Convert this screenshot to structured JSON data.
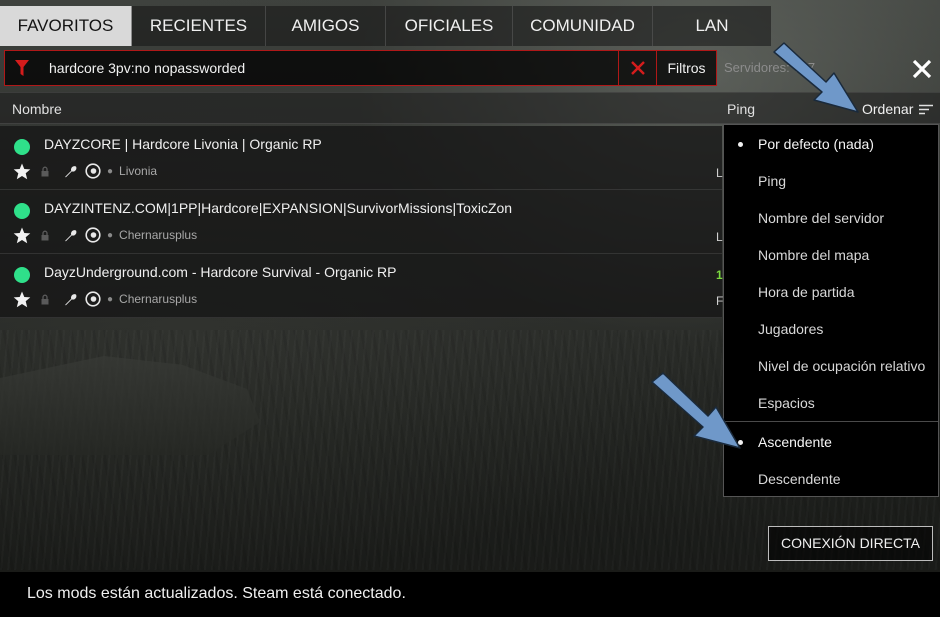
{
  "tabs": [
    {
      "label": "FAVORITOS",
      "active": true
    },
    {
      "label": "RECIENTES",
      "active": false
    },
    {
      "label": "AMIGOS",
      "active": false
    },
    {
      "label": "OFICIALES",
      "active": false
    },
    {
      "label": "COMUNIDAD",
      "active": false
    },
    {
      "label": "LAN",
      "active": false
    }
  ],
  "search": {
    "value": "hardcore 3pv:no nopassworded",
    "filters_label": "Filtros",
    "servers_count": "Servidores: ?/ 7"
  },
  "columns": {
    "name": "Nombre",
    "ping": "Ping",
    "sort_label": "Ordenar"
  },
  "servers": [
    {
      "name": "DAYZCORE | Hardcore Livonia | Organic RP",
      "map": "Livonia",
      "right_peek": "L",
      "right_peek_top": ""
    },
    {
      "name": "DAYZINTENZ.COM|1PP|Hardcore|EXPANSION|SurvivorMissions|ToxicZon",
      "map": "Chernarusplus",
      "right_peek": "L",
      "right_peek_top": ""
    },
    {
      "name": "DayzUnderground.com - Hardcore Survival - Organic RP",
      "map": "Chernarusplus",
      "right_peek": "F",
      "right_peek_top": "1"
    }
  ],
  "sort_menu": {
    "items": [
      {
        "label": "Por defecto (nada)",
        "selected": true
      },
      {
        "label": "Ping",
        "selected": false
      },
      {
        "label": "Nombre del servidor",
        "selected": false
      },
      {
        "label": "Nombre del mapa",
        "selected": false
      },
      {
        "label": "Hora de partida",
        "selected": false
      },
      {
        "label": "Jugadores",
        "selected": false
      },
      {
        "label": "Nivel de ocupación relativo",
        "selected": false
      },
      {
        "label": "Espacios",
        "selected": false
      }
    ],
    "order": [
      {
        "label": "Ascendente",
        "selected": true
      },
      {
        "label": "Descendente",
        "selected": false
      }
    ]
  },
  "direct_connect_label": "CONEXIÓN DIRECTA",
  "status_text": "Los mods están actualizados. Steam está conectado.",
  "colors": {
    "accent_red": "#b01818",
    "online_green": "#2fe08a",
    "arrow_blue": "#6f98c9"
  },
  "icons": [
    "filter-icon",
    "clear-icon",
    "close-icon",
    "sort-lines-icon",
    "star-icon",
    "lock-icon",
    "wrench-icon",
    "eye-icon"
  ]
}
